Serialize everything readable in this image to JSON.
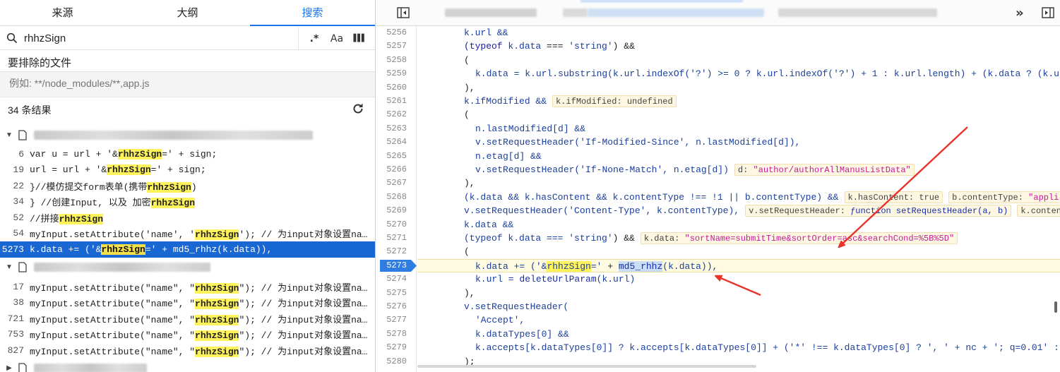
{
  "left_panel": {
    "tabs": [
      {
        "label": "来源"
      },
      {
        "label": "大纲"
      },
      {
        "label": "搜索"
      }
    ],
    "search": {
      "value": "rhhzSign",
      "opt_regex": ".*",
      "opt_case": "Aa",
      "opt_word": "▌▌▌"
    },
    "exclude": {
      "label": "要排除的文件",
      "placeholder": "例如: **/node_modules/**,app.js"
    },
    "result_count": "34 条结果",
    "groups": [
      {
        "results": [
          {
            "line": "6",
            "pre": "var u = url + '&",
            "match": "rhhzSign",
            "post": "=' + sign;"
          },
          {
            "line": "19",
            "pre": "url = url + '&",
            "match": "rhhzSign",
            "post": "=' + sign;"
          },
          {
            "line": "22",
            "pre": "}//模仿提交form表单(携带",
            "match": "rhhzSign",
            "post": ")"
          },
          {
            "line": "34",
            "pre": "} //创建Input, 以及 加密",
            "match": "rhhzSign",
            "post": ""
          },
          {
            "line": "52",
            "pre": "//拼接",
            "match": "rhhzSign",
            "post": ""
          },
          {
            "line": "54",
            "pre": "myInput.setAttribute('name', '",
            "match": "rhhzSign",
            "post": "'); // 为input对象设置na…"
          },
          {
            "line": "5273",
            "pre": "k.data += ('&",
            "match": "rhhzSign",
            "post": "=' + md5_rhhz(k.data)),"
          }
        ]
      },
      {
        "results": [
          {
            "line": "17",
            "pre": "myInput.setAttribute(\"name\", \"",
            "match": "rhhzSign",
            "post": "\"); // 为input对象设置na…"
          },
          {
            "line": "38",
            "pre": "myInput.setAttribute(\"name\", \"",
            "match": "rhhzSign",
            "post": "\"); // 为input对象设置na…"
          },
          {
            "line": "721",
            "pre": "myInput.setAttribute(\"name\", \"",
            "match": "rhhzSign",
            "post": "\"); // 为input对象设置na…"
          },
          {
            "line": "753",
            "pre": "myInput.setAttribute(\"name\", \"",
            "match": "rhhzSign",
            "post": "\"); // 为input对象设置na…"
          },
          {
            "line": "827",
            "pre": "myInput.setAttribute(\"name\", \"",
            "match": "rhhzSign",
            "post": "\"); // 为input对象设置na…"
          }
        ]
      }
    ]
  },
  "editor": {
    "gutter_lines": [
      "5256",
      "5257",
      "5258",
      "5259",
      "5260",
      "5261",
      "5262",
      "5263",
      "5264",
      "5265",
      "5266",
      "5267",
      "5268",
      "5269",
      "5270",
      "5271",
      "5272",
      "5273",
      "5274",
      "5275",
      "5276",
      "5277",
      "5278",
      "5279",
      "5280"
    ],
    "current_line": "5273",
    "code": {
      "l5256": "k.url &&",
      "l5257a": "(typeof ",
      "l5257b": "k.data",
      "l5257c": " === ",
      "l5257d": "'string'",
      "l5257e": ") &&",
      "l5258": "(",
      "l5259": "k.data = k.url.substring(k.url.indexOf('?') >= 0 ? k.url.indexOf('?') + 1 : k.url.length) + (k.data ? (k.u",
      "l5260": "),",
      "l5261a": "k.ifModified &&",
      "l5261k": "k.ifModified:",
      "l5261v": "undefined",
      "l5262": "(",
      "l5263": "n.lastModified[d] &&",
      "l5264a": "v.setRequestHeader(",
      "l5264b": "'If-Modified-Since'",
      "l5264c": ", n.lastModified[d]),",
      "l5265": "n.etag[d] &&",
      "l5266a": "v.setRequestHeader(",
      "l5266b": "'If-None-Match'",
      "l5266c": ", n.etag[d])",
      "l5266k": "d:",
      "l5266v": "\"author/authorAllManusListData\"",
      "l5267": "),",
      "l5268a": "(k.data && k.hasContent && k.contentType !== !1 || b.contentType) &&",
      "l5268k1": "k.hasContent:",
      "l5268v1": "true",
      "l5268k2": "b.contentType:",
      "l5268v2": "\"appli",
      "l5269a": "v.setRequestHeader(",
      "l5269b": "'Content-Type'",
      "l5269c": ", k.contentType),",
      "l5269k": "v.setRequestHeader:",
      "l5269v": "ƒunction setRequestHeader(a, b)",
      "l5269k2": "k.conten",
      "l5270": "k.data &&",
      "l5271a": "(typeof k.data === ",
      "l5271b": "'string'",
      "l5271c": ") &&",
      "l5271k": "k.data:",
      "l5271v": "\"sortName=submitTime&sortOrder=asc&searchCond=%5B%5D\"",
      "l5272": "(",
      "l5273a": "k.data += (",
      "l5273b": "'&",
      "l5273c": "rhhzSign",
      "l5273d": "='",
      "l5273e": " + ",
      "l5273f": "md5_rhhz",
      "l5273g": "(k.data)),",
      "l5274a": "k.url = ",
      "l5274b": "deleteUrlParam",
      "l5274c": "(k.url)",
      "l5275": "),",
      "l5276": "v.setRequestHeader(",
      "l5277": "'Accept',",
      "l5278": "k.dataTypes[0] &&",
      "l5279": "k.accepts[k.dataTypes[0]] ? k.accepts[k.dataTypes[0]] + ('*' !== k.dataTypes[0] ? ', ' + nc + '; q=0.01' :",
      "l5280": ");"
    }
  },
  "colors": {
    "accent": "#1a73e8",
    "selection": "#1967d2",
    "match_highlight": "#fff35b",
    "annotation_arrow": "#e8322a"
  },
  "icons": [
    "search-icon",
    "refresh-icon",
    "file-icon",
    "chevron-down-icon",
    "toggle-sidebar-icon",
    "double-chevron-right-icon",
    "toggle-panel-icon"
  ]
}
